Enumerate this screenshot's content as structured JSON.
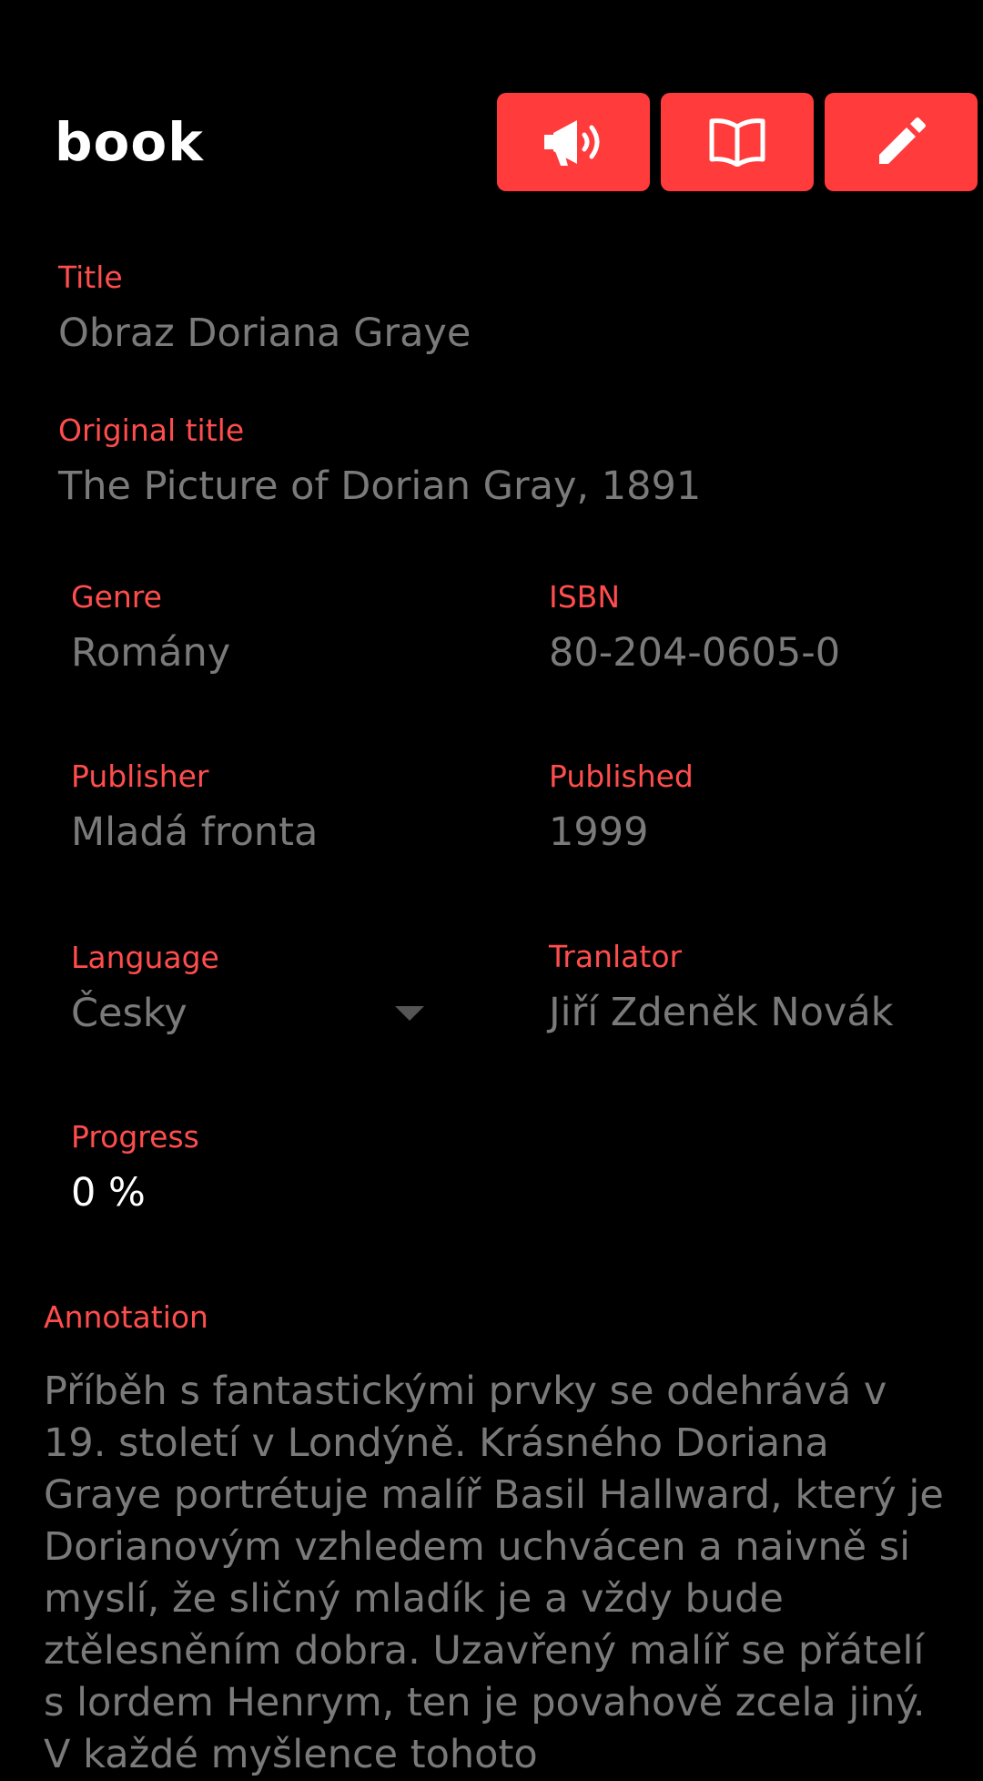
{
  "header": {
    "title": "book",
    "buttons": [
      {
        "name": "speak",
        "icon": "megaphone-icon"
      },
      {
        "name": "read",
        "icon": "open-book-icon"
      },
      {
        "name": "edit",
        "icon": "pencil-icon"
      }
    ],
    "accent_color": "#ff3b3b"
  },
  "fields": {
    "title": {
      "label": "Title",
      "value": "Obraz Doriana Graye"
    },
    "original_title": {
      "label": "Original title",
      "value": "The Picture of Dorian Gray, 1891"
    },
    "genre": {
      "label": "Genre",
      "value": "Romány"
    },
    "isbn": {
      "label": "ISBN",
      "value": "80-204-0605-0"
    },
    "publisher": {
      "label": "Publisher",
      "value": "Mladá fronta"
    },
    "published": {
      "label": "Published",
      "value": "1999"
    },
    "language": {
      "label": "Language",
      "value": "Česky"
    },
    "translator": {
      "label": "Tranlator",
      "value": "Jiří Zdeněk Novák"
    },
    "progress": {
      "label": "Progress",
      "value": "0 %"
    }
  },
  "annotation": {
    "label": "Annotation",
    "text": "Příběh s fantastickými prvky se odehrává v 19. století v Londýně. Krásného Doriana Graye portrétuje malíř Basil Hallward, který je Dorianovým vzhledem uchvácen a naivně si myslí, že sličný mladík je a vždy bude ztělesněním dobra. Uzavřený malíř se přátelí s lordem Henrym, ten je povahově zcela jiný. V každé myšlence tohoto"
  }
}
